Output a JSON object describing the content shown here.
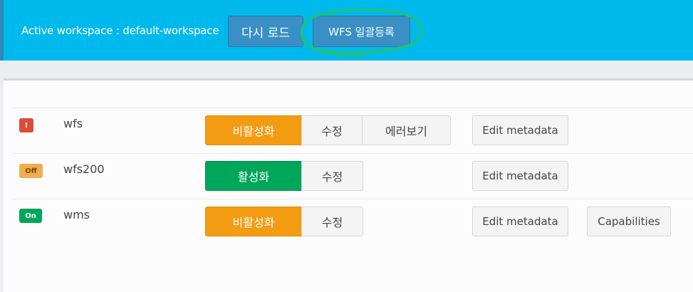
{
  "header": {
    "workspace_label": "Active workspace : default-workspace",
    "reload_button": "다시 로드",
    "wfs_bulk_button": "WFS 일괄등록"
  },
  "services": [
    {
      "status_badge": "!",
      "name": "wfs",
      "toggle_label": "비활성화",
      "edit_label": "수정",
      "error_label": "에러보기",
      "metadata_label": "Edit metadata"
    },
    {
      "status_badge": "Off",
      "name": "wfs200",
      "toggle_label": "활성화",
      "edit_label": "수정",
      "metadata_label": "Edit metadata"
    },
    {
      "status_badge": "On",
      "name": "wms",
      "toggle_label": "비활성화",
      "edit_label": "수정",
      "metadata_label": "Edit metadata",
      "capabilities_label": "Capabilities"
    }
  ],
  "colors": {
    "header_bg": "#00b9ec",
    "header_button": "#3a8fc4",
    "annotation_green": "#19c08a",
    "disable_orange": "#f39c12",
    "enable_green": "#00a65a",
    "error_red": "#dd4b39",
    "off_amber": "#f0ad4e"
  }
}
